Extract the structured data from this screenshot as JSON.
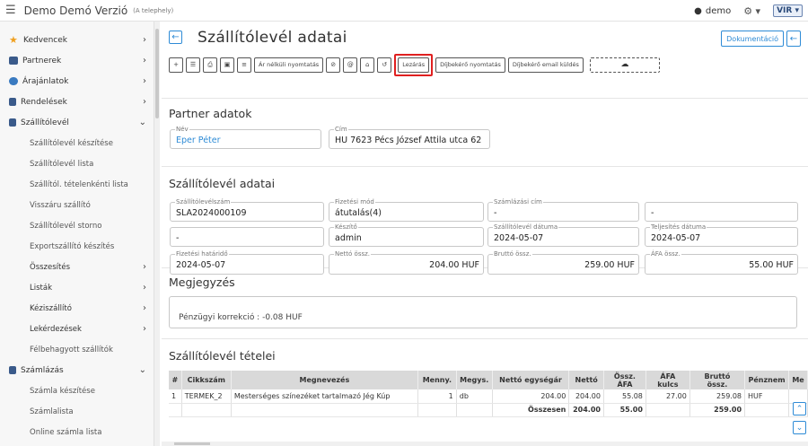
{
  "topbar": {
    "app_title": "Demo Demó Verzió",
    "subtitle": "(A telephely)",
    "user": "demo",
    "logo": "VIR"
  },
  "sidebar": {
    "items": [
      {
        "label": "Kedvencek",
        "icon": "star-icon",
        "color": "#f0a020"
      },
      {
        "label": "Partnerek",
        "icon": "contact-card-icon",
        "color": "#3a5a8a"
      },
      {
        "label": "Árajánlatok",
        "icon": "users-icon",
        "color": "#3a7ac0"
      },
      {
        "label": "Rendelések",
        "icon": "document-icon",
        "color": "#3a5a8a"
      },
      {
        "label": "Szállítólevél",
        "icon": "clipboard-icon",
        "color": "#3a5a8a"
      }
    ],
    "sub_items": [
      {
        "label": "Szállítólevél készítése"
      },
      {
        "label": "Szállítólevél lista"
      },
      {
        "label": "Szállítól. tételenkénti lista"
      },
      {
        "label": "Visszáru szállító"
      },
      {
        "label": "Szállítólevél storno"
      },
      {
        "label": "Exportszállító készítés"
      },
      {
        "label": "Összesítés"
      },
      {
        "label": "Listák"
      },
      {
        "label": "Kéziszállító"
      },
      {
        "label": "Lekérdezések"
      },
      {
        "label": "Félbehagyott szállítók"
      }
    ],
    "szamlazas": {
      "label": "Számlázás",
      "icon": "document-icon"
    },
    "szamlazas_sub": [
      {
        "label": "Számla készítése"
      },
      {
        "label": "Számlalista"
      },
      {
        "label": "Online számla lista"
      }
    ]
  },
  "header": {
    "title": "Szállítólevél adatai",
    "doc_button": "Dokumentáció"
  },
  "toolbar": {
    "ar_nelkuli": "Ár nélküli nyomtatás",
    "lezaras": "Lezárás",
    "dijbekero_nyomtatas": "Díjbekérő nyomtatás",
    "dijbekero_email": "Díjbekérő email küldés"
  },
  "partner": {
    "section_title": "Partner adatok",
    "nev_label": "Név",
    "nev": "Eper Péter",
    "cim_label": "Cím",
    "cim": "HU 7623 Pécs József Attila utca 62"
  },
  "szallito": {
    "section_title": "Szállítólevél adatai",
    "fields": {
      "szam_label": "Szállítólevélszám",
      "szam": "SLA2024000109",
      "fizmod_label": "Fizetési mód",
      "fizmod": "átutalás(4)",
      "szamlcim_label": "Számlázási cím",
      "szamlcim": "-",
      "empty1": "-",
      "empty2": "-",
      "keszito_label": "Készítő",
      "keszito": "admin",
      "datum_label": "Szállítólevél dátuma",
      "datum": "2024-05-07",
      "telj_label": "Teljesítés dátuma",
      "telj": "2024-05-07",
      "hatarido_label": "Fizetési határidő",
      "hatarido": "2024-05-07",
      "netto_label": "Nettó össz.",
      "netto": "204.00 HUF",
      "brutto_label": "Bruttó össz.",
      "brutto": "259.00 HUF",
      "afa_label": "ÁFA össz.",
      "afa": "55.00 HUF"
    }
  },
  "megjegyzes": {
    "section_title": "Megjegyzés",
    "text": "Pénzügyi korrekció : -0.08 HUF"
  },
  "tetelek": {
    "section_title": "Szállítólevél tételei",
    "columns": [
      "#",
      "Cikkszám",
      "Megnevezés",
      "Menny.",
      "Megys.",
      "Nettó egységár",
      "Nettó",
      "Össz. ÁFA",
      "ÁFA kulcs",
      "Bruttó össz.",
      "Pénznem",
      "Me"
    ],
    "rows": [
      [
        "1",
        "TERMEK_2",
        "Mesterséges színezéket tartalmazó Jég Kúp",
        "1",
        "db",
        "204.00",
        "204.00",
        "55.08",
        "27.00",
        "259.08",
        "HUF",
        ""
      ]
    ],
    "total": {
      "label": "Összesen",
      "netto": "204.00",
      "afa": "55.00",
      "brutto": "259.00"
    }
  }
}
